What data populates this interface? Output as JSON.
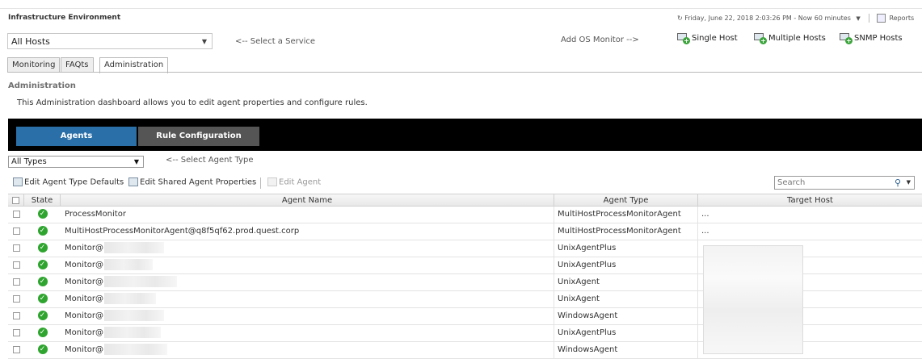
{
  "header": {
    "title": "Infrastructure Environment",
    "datetime": "Friday, June 22, 2018 2:03:26 PM - Now 60 minutes",
    "reports_label": "Reports"
  },
  "service_select": {
    "value": "All Hosts",
    "hint": "<-- Select a Service"
  },
  "add_monitor": {
    "label": "Add OS Monitor -->",
    "single_host": "Single Host",
    "multiple_hosts": "Multiple Hosts",
    "snmp_hosts": "SNMP Hosts"
  },
  "tabs": [
    {
      "label": "Monitoring"
    },
    {
      "label": "FAQts"
    },
    {
      "label": "Administration"
    }
  ],
  "admin": {
    "heading": "Administration",
    "description": "This Administration dashboard allows you to edit agent properties and configure rules."
  },
  "subnav": {
    "agents": "Agents",
    "rule_configuration": "Rule Configuration"
  },
  "type_select": {
    "value": "All Types",
    "hint": "<-- Select Agent Type"
  },
  "toolbar": {
    "edit_defaults": "Edit Agent Type Defaults",
    "edit_shared": "Edit Shared Agent Properties",
    "edit_agent": "Edit Agent",
    "search_placeholder": "Search"
  },
  "grid": {
    "columns": {
      "state": "State",
      "agent_name": "Agent Name",
      "agent_type": "Agent Type",
      "target_host": "Target Host"
    },
    "rows": [
      {
        "name": "ProcessMonitor",
        "type": "MultiHostProcessMonitorAgent",
        "target": "..."
      },
      {
        "name": "MultiHostProcessMonitorAgent@q8f5qf62.prod.quest.corp",
        "type": "MultiHostProcessMonitorAgent",
        "target": "..."
      },
      {
        "name": "Monitor@",
        "type": "UnixAgentPlus",
        "target": ""
      },
      {
        "name": "Monitor@",
        "type": "UnixAgentPlus",
        "target": ""
      },
      {
        "name": "Monitor@",
        "type": "UnixAgent",
        "target": ""
      },
      {
        "name": "Monitor@",
        "type": "UnixAgent",
        "target": ""
      },
      {
        "name": "Monitor@",
        "type": "WindowsAgent",
        "target": ""
      },
      {
        "name": "Monitor@",
        "type": "UnixAgentPlus",
        "target": ""
      },
      {
        "name": "Monitor@",
        "type": "WindowsAgent",
        "target": ""
      }
    ]
  },
  "colors": {
    "agents_tab": "#2a6fa8",
    "rule_tab": "#555555",
    "state_ok": "#2fa52f",
    "nav_bar": "#000000"
  }
}
